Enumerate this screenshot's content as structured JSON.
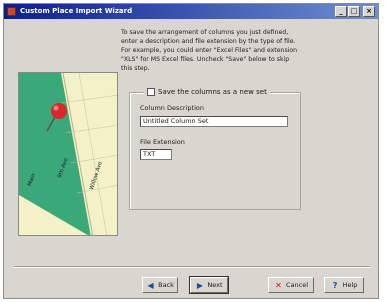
{
  "window": {
    "title": "Custom Place Import Wizard",
    "controls": {
      "minimize": "_",
      "maximize": "□",
      "close": "×"
    }
  },
  "instructions": "To save the arrangement of columns you just defined, enter a description and file extension by the type of file. For example, you could enter \"Excel Files\" and extension \"XLS\" for MS Excel files. Uncheck \"Save\" below to skip this step.",
  "form": {
    "save_checkbox_label": "Save the columns as a new set",
    "save_checked": false,
    "column_description_label": "Column Description",
    "column_description_value": "Untitled Column Set",
    "file_extension_label": "File Extension",
    "file_extension_value": "TXT"
  },
  "map": {
    "street_labels": [
      "Main",
      "9th Ave",
      "Willow Ave"
    ]
  },
  "buttons": {
    "back": "Back",
    "next": "Next",
    "cancel": "Cancel",
    "help": "Help"
  },
  "icons": {
    "back": "arrow-left-icon",
    "next": "arrow-right-icon",
    "cancel": "red-x-icon",
    "help": "question-mark-icon",
    "pin": "pushpin-icon"
  },
  "colors": {
    "titlebar_start": "#0a1f8a",
    "titlebar_end": "#6f8ed6",
    "map_green": "#3aa878",
    "map_land": "#f4f0c8",
    "pin_red": "#d8282a",
    "cancel_red": "#cc1111"
  }
}
